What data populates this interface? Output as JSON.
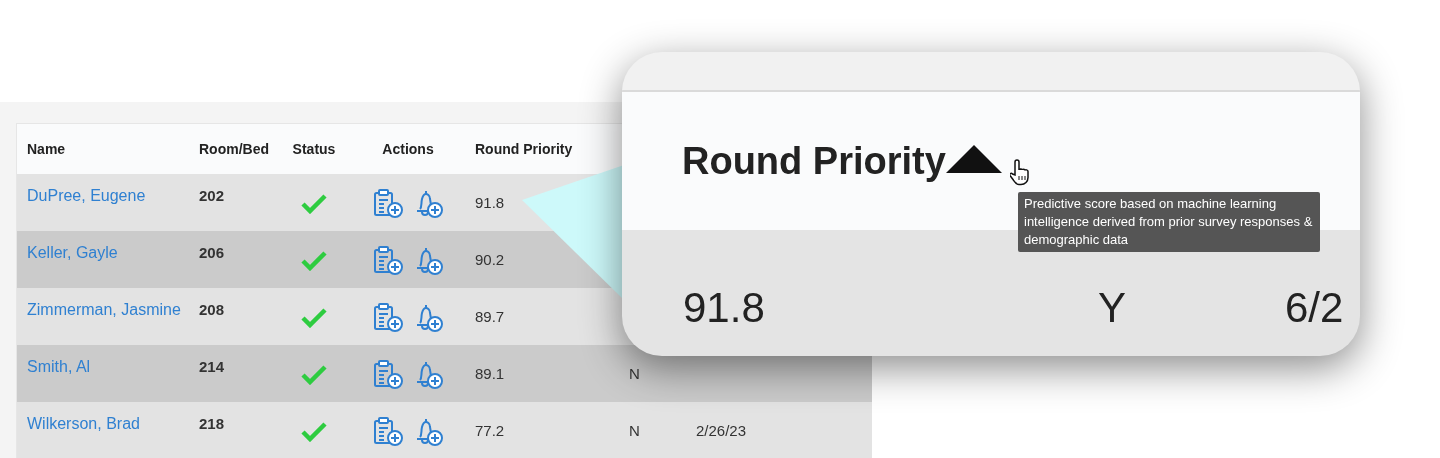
{
  "table": {
    "columns": [
      "Name",
      "Room/Bed",
      "Status",
      "Actions",
      "Round Priority"
    ],
    "rows": [
      {
        "name": "DuPree, Eugene",
        "room": "202",
        "checked": true,
        "priority": "91.8"
      },
      {
        "name": "Keller, Gayle",
        "room": "206",
        "checked": true,
        "priority": "90.2"
      },
      {
        "name": "Zimmerman, Jasmine",
        "room": "208",
        "checked": true,
        "priority": "89.7"
      },
      {
        "name": "Smith, Al",
        "room": "214",
        "checked": true,
        "priority": "89.1",
        "column_6": "N"
      },
      {
        "name": "Wilkerson, Brad",
        "room": "218",
        "checked": true,
        "priority": "77.2",
        "column_6": "N",
        "column_7": "2/26/23"
      }
    ]
  },
  "callout": {
    "header": "Round Priority",
    "sorted_ascending": true,
    "tooltip": "Predictive score based on machine learning intelligence derived from prior survey responses & demographic data",
    "cells": [
      "91.8",
      "Y",
      "6/2"
    ]
  }
}
